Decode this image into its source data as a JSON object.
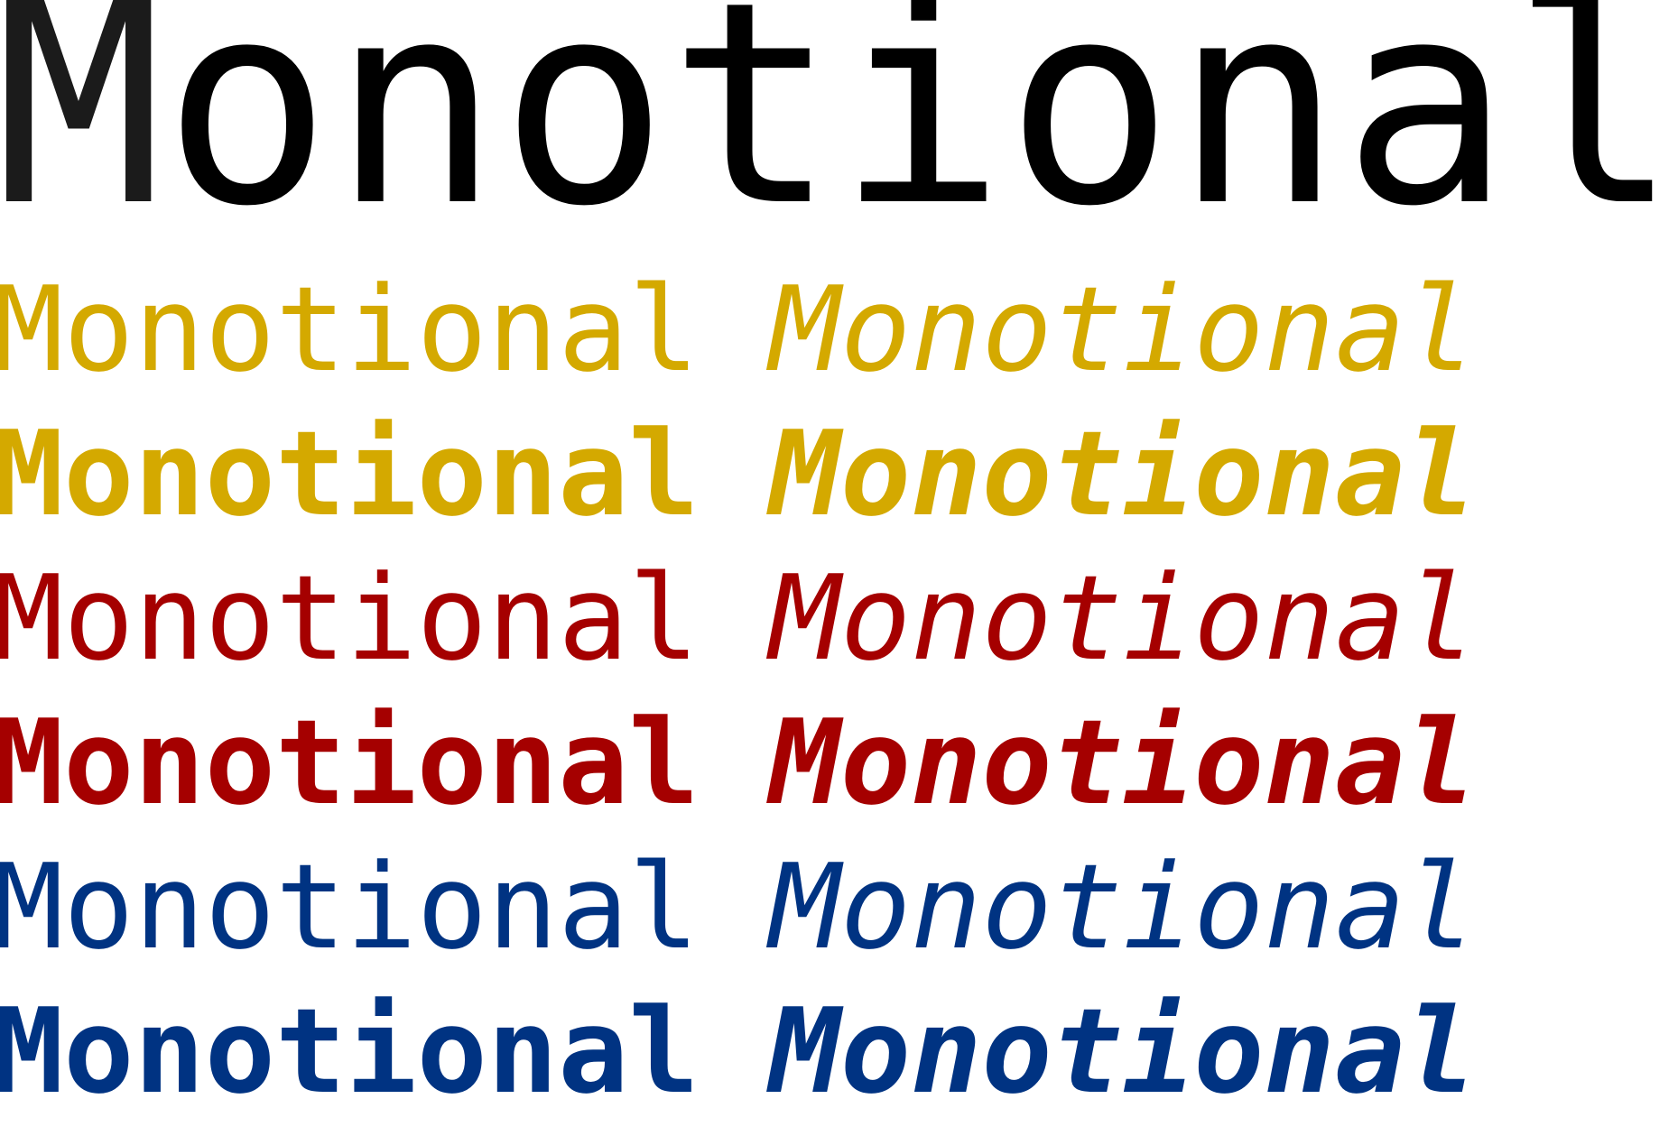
{
  "hero": {
    "first_letter": "M",
    "rest": "onotional",
    "color": "#000000",
    "first_letter_color": "#1b1b1b"
  },
  "rows": [
    {
      "upright": "Monotional",
      "oblique": "Monotional",
      "weight": "regular",
      "color": "#d4a900"
    },
    {
      "upright": "Monotional",
      "oblique": "Monotional",
      "weight": "bold",
      "color": "#d4a900"
    },
    {
      "upright": "Monotional",
      "oblique": "Monotional",
      "weight": "regular",
      "color": "#a50000"
    },
    {
      "upright": "Monotional",
      "oblique": "Monotional",
      "weight": "bold",
      "color": "#a50000"
    },
    {
      "upright": "Monotional",
      "oblique": "Monotional",
      "weight": "regular",
      "color": "#003382"
    },
    {
      "upright": "Monotional",
      "oblique": "Monotional",
      "weight": "bold",
      "color": "#003382"
    }
  ]
}
